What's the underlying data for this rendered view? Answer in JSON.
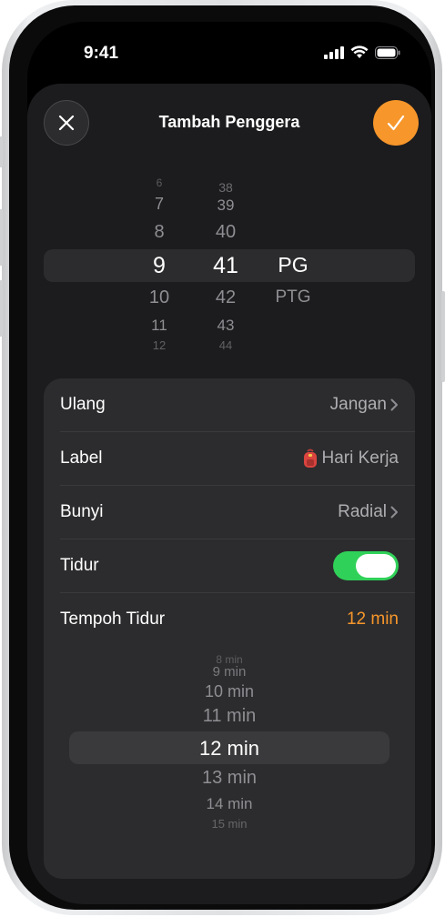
{
  "status_bar": {
    "time": "9:41"
  },
  "header": {
    "title": "Tambah Penggera"
  },
  "time_picker": {
    "hours": [
      "6",
      "7",
      "8",
      "9",
      "10",
      "11",
      "12"
    ],
    "minutes": [
      "38",
      "39",
      "40",
      "41",
      "42",
      "43",
      "44"
    ],
    "periods": [
      "PG",
      "PTG"
    ],
    "selected": {
      "hour": "9",
      "minute": "41",
      "period": "PG"
    }
  },
  "settings": {
    "repeat": {
      "label": "Ulang",
      "value": "Jangan"
    },
    "label": {
      "label": "Label",
      "value": "Hari Kerja"
    },
    "sound": {
      "label": "Bunyi",
      "value": "Radial"
    },
    "sleep": {
      "label": "Tidur",
      "on": true
    },
    "sleep_duration": {
      "label": "Tempoh Tidur",
      "value": "12 min"
    }
  },
  "duration_picker": {
    "options": [
      "8 min",
      "9 min",
      "10 min",
      "11 min",
      "12 min",
      "13 min",
      "14 min",
      "15 min"
    ],
    "selected": "12 min"
  },
  "colors": {
    "accent": "#f7962b",
    "toggle_on": "#30d158",
    "sheet": "#1c1c1e",
    "group": "#2c2c2e"
  },
  "icons": {
    "close": "close-icon",
    "confirm": "checkmark-icon",
    "label_emoji": "backpack-icon"
  }
}
